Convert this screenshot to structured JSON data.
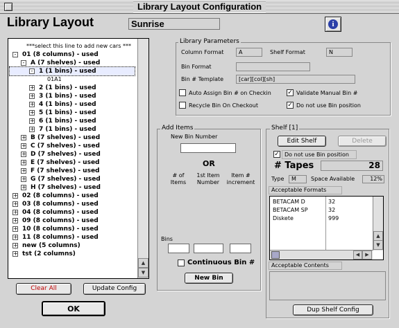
{
  "window": {
    "title": "Library Layout Configuration"
  },
  "header": {
    "heading": "Library Layout",
    "library_name": "Sunrise",
    "info_glyph": "i"
  },
  "tree": {
    "rows": [
      {
        "label": "***select this line to add new cars ***",
        "expander": "",
        "style": "normal"
      },
      {
        "label": "01 (8 columns) - used",
        "expander": "-",
        "style": "bold"
      },
      {
        "label": "A (7 shelves) - used",
        "expander": "-",
        "style": "bold"
      },
      {
        "label": "1 (1 bins) - used",
        "expander": "-",
        "style": "bold",
        "selected": true
      },
      {
        "label": "01A1",
        "expander": "",
        "style": "normal"
      },
      {
        "label": "2 (1 bins) - used",
        "expander": "+",
        "style": "bold"
      },
      {
        "label": "3 (1 bins) - used",
        "expander": "+",
        "style": "bold"
      },
      {
        "label": "4 (1 bins) - used",
        "expander": "+",
        "style": "bold"
      },
      {
        "label": "5 (1 bins) - used",
        "expander": "+",
        "style": "bold"
      },
      {
        "label": "6 (1 bins) - used",
        "expander": "+",
        "style": "bold"
      },
      {
        "label": "7 (1 bins) - used",
        "expander": "+",
        "style": "bold"
      },
      {
        "label": "B (7 shelves) - used",
        "expander": "+",
        "style": "bold"
      },
      {
        "label": "C (7 shelves) - used",
        "expander": "+",
        "style": "bold"
      },
      {
        "label": "D (7 shelves) - used",
        "expander": "+",
        "style": "bold"
      },
      {
        "label": "E (7 shelves) - used",
        "expander": "+",
        "style": "bold"
      },
      {
        "label": "F (7 shelves) - used",
        "expander": "+",
        "style": "bold"
      },
      {
        "label": "G (7 shelves) - used",
        "expander": "+",
        "style": "bold"
      },
      {
        "label": "H (7 shelves) - used",
        "expander": "+",
        "style": "bold"
      },
      {
        "label": "02 (8 columns) - used",
        "expander": "+",
        "style": "bold"
      },
      {
        "label": "03 (8 columns) - used",
        "expander": "+",
        "style": "bold"
      },
      {
        "label": "04 (8 columns) - used",
        "expander": "+",
        "style": "bold"
      },
      {
        "label": "09 (8 columns) - used",
        "expander": "+",
        "style": "bold"
      },
      {
        "label": "10 (8 columns) - used",
        "expander": "+",
        "style": "bold"
      },
      {
        "label": "11 (8 columns) - used",
        "expander": "+",
        "style": "bold"
      },
      {
        "label": "new (5 columns)",
        "expander": "+",
        "style": "bold"
      },
      {
        "label": "tst (2 columns)",
        "expander": "+",
        "style": "bold"
      }
    ]
  },
  "buttons": {
    "clear_all": "Clear All",
    "update_config": "Update Config",
    "ok": "OK",
    "new_bin": "New Bin",
    "edit_shelf": "Edit Shelf",
    "delete": "Delete",
    "dup_shelf_config": "Dup Shelf Config"
  },
  "library_params": {
    "title": "Library Parameters",
    "column_format_label": "Column Format",
    "column_format_value": "A",
    "shelf_format_label": "Shelf Format",
    "shelf_format_value": "N",
    "bin_format_label": "Bin Format",
    "bin_format_value": "",
    "bin_template_label": "Bin # Template",
    "bin_template_value": "[car][col][sh]",
    "auto_assign_label": "Auto Assign Bin # on Checkin",
    "auto_assign_checked": false,
    "validate_manual_label": "Validate Manual Bin #",
    "validate_manual_checked": true,
    "recycle_label": "Recycle Bin On Checkout",
    "recycle_checked": false,
    "no_bin_position_label": "Do not use Bin position",
    "no_bin_position_checked": true
  },
  "add_items": {
    "title": "Add Items",
    "new_bin_number_label": "New Bin Number",
    "or_label": "OR",
    "num_items_label": "# of Items",
    "first_item_label": "1st Item Number",
    "increment_label": "Item # increment",
    "bins_label": "Bins",
    "continuous_label": "Continuous Bin #",
    "continuous_checked": false
  },
  "shelf": {
    "title": "Shelf [1]",
    "no_bin_position_label": "Do not use Bin position",
    "no_bin_position_checked": true,
    "tapes_label": "# Tapes",
    "tapes_value": "28",
    "type_label": "Type",
    "type_value": "M",
    "space_label": "Space Available",
    "space_value": "12%",
    "acceptable_formats_label": "Acceptable Formats",
    "formats": [
      {
        "name": "BETACAM D",
        "value": "32"
      },
      {
        "name": "BETACAM SP",
        "value": "32"
      },
      {
        "name": "Diskete",
        "value": "999"
      }
    ],
    "acceptable_contents_label": "Acceptable Contents"
  }
}
